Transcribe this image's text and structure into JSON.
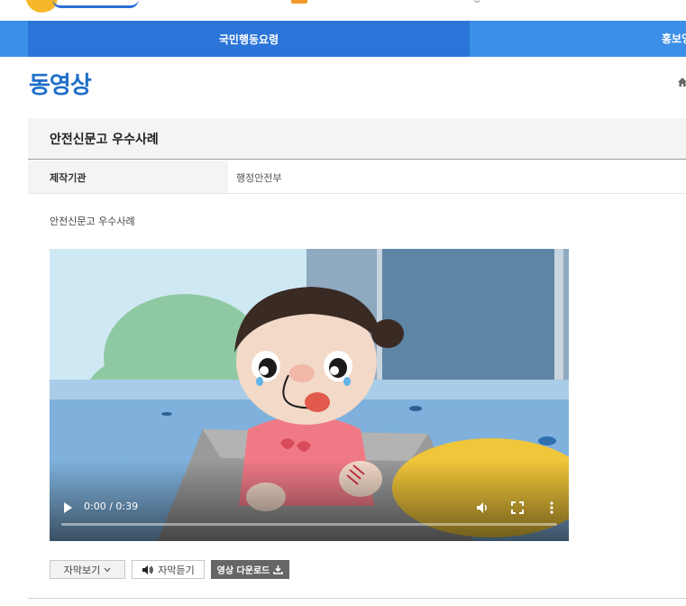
{
  "gnb": {
    "active_item": "국민행동요령",
    "item2": "홍보영"
  },
  "page": {
    "title": "동영상"
  },
  "post": {
    "title": "안전신문고 우수사례",
    "producer_label": "제작기관",
    "producer_value": "행정안전부",
    "description": "안전신문고 우수사례"
  },
  "video": {
    "time": "0:00 / 0:39",
    "progress": 0
  },
  "buttons": {
    "subtitle_view": "자막보기",
    "subtitle_listen": "자막듣기",
    "download": "영상 다운로드"
  },
  "icons": {
    "home": "home-icon",
    "play": "play-icon",
    "volume": "volume-icon",
    "fullscreen": "fullscreen-icon",
    "more": "more-vertical-icon",
    "download": "download-icon",
    "speaker": "speaker-icon",
    "dropdown": "chevron-down-icon"
  },
  "colors": {
    "brand_blue": "#1f6fc9",
    "nav_blue": "#3b8fe6",
    "nav_active": "#2b75d8"
  }
}
